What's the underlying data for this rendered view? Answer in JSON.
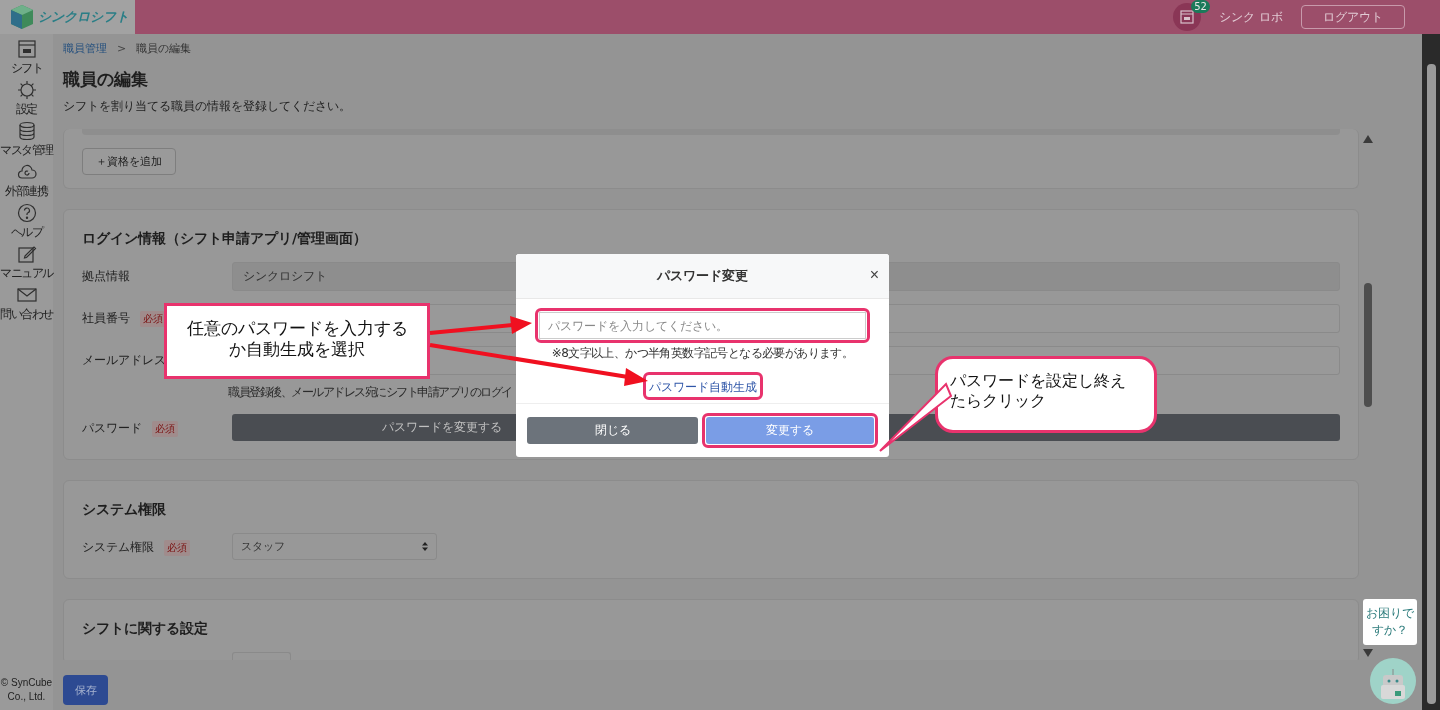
{
  "header": {
    "logo": "シンクロシフト",
    "notification_count": "52",
    "user_name": "シンク ロボ",
    "logout": "ログアウト"
  },
  "sidebar": {
    "items": [
      {
        "label": "シフト"
      },
      {
        "label": "設定"
      },
      {
        "label": "マスタ管理"
      },
      {
        "label": "外部連携"
      },
      {
        "label": "ヘルプ"
      },
      {
        "label": "マニュアル"
      },
      {
        "label": "問い合わせ"
      }
    ],
    "copyright": "© SynCube Co., Ltd."
  },
  "breadcrumb": {
    "separator": ">",
    "items": [
      {
        "label": "職員管理",
        "kind": "link"
      },
      {
        "label": "職員の編集",
        "kind": "current"
      }
    ]
  },
  "page": {
    "title": "職員の編集",
    "description": "シフトを割り当てる職員の情報を登録してください。"
  },
  "qualification_button": "＋資格を追加",
  "login_section": {
    "title": "ログイン情報（シフト申請アプリ/管理画面）",
    "fields": [
      {
        "label": "拠点情報",
        "kind": "readonly",
        "value": "シンクロシフト"
      },
      {
        "label": "社員番号",
        "badge": "必須",
        "kind": "text"
      },
      {
        "label": "メールアドレス",
        "kind": "text",
        "help": "職員登録後、メールアドレス宛にシフト申請アプリのログイ"
      },
      {
        "label": "パスワード",
        "badge": "必須",
        "kind": "button",
        "value": "パスワードを変更する"
      }
    ]
  },
  "system_section": {
    "title": "システム権限",
    "fields": [
      {
        "label": "システム権限",
        "badge": "必須",
        "kind": "select",
        "value": "スタッフ"
      }
    ]
  },
  "shift_section": {
    "title": "シフトに関する設定"
  },
  "save_button": "保存",
  "help_bubble": "お困りですか？",
  "modal": {
    "title": "パスワード変更",
    "close": "×",
    "placeholder": "パスワードを入力してください。",
    "note": "※8文字以上、かつ半角英数字記号となる必要があります。",
    "generate_link": "パスワード自動生成",
    "buttons": [
      {
        "label": "閉じる",
        "kind": "secondary"
      },
      {
        "label": "変更する",
        "kind": "primary"
      }
    ]
  },
  "annotations": [
    {
      "text": "任意のパスワードを入力するか自動生成を選択"
    },
    {
      "text": "パスワードを設定し終えたらクリック"
    }
  ]
}
